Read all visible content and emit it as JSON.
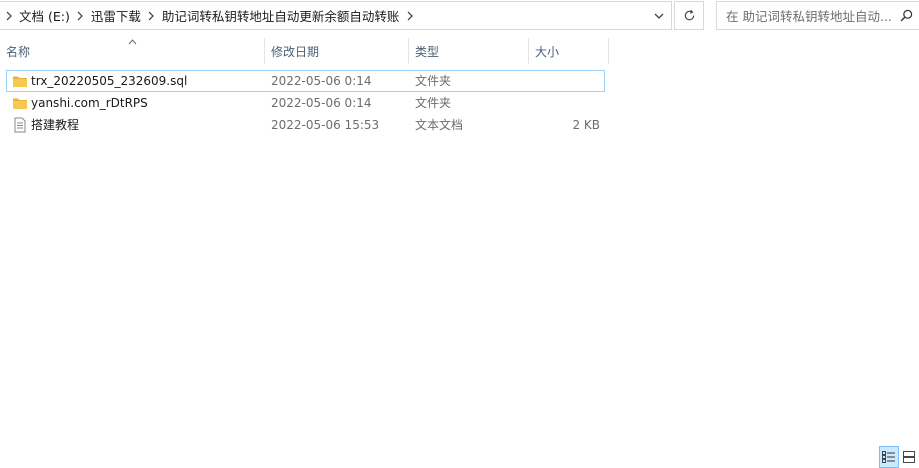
{
  "window": {
    "breadcrumbs": [
      "文档 (E:)",
      "迅雷下载",
      "助记词转私钥转地址自动更新余额自动转账"
    ]
  },
  "search": {
    "placeholder": "在 助记词转私钥转地址自动..."
  },
  "columns": {
    "name": "名称",
    "date": "修改日期",
    "type": "类型",
    "size": "大小"
  },
  "files": [
    {
      "name": "trx_20220505_232609.sql",
      "date": "2022-05-06 0:14",
      "type": "文件夹",
      "size": "",
      "icon": "folder-icon",
      "selected": true
    },
    {
      "name": "yanshi.com_rDtRPS",
      "date": "2022-05-06 0:14",
      "type": "文件夹",
      "size": "",
      "icon": "folder-icon",
      "selected": false
    },
    {
      "name": "搭建教程",
      "date": "2022-05-06 15:53",
      "type": "文本文档",
      "size": "2 KB",
      "icon": "text-document-icon",
      "selected": false
    }
  ],
  "colors": {
    "selection_border": "#99d1ff",
    "folder": "#f6c94e",
    "header_text": "#4c607a",
    "view_active": "#cce8ff"
  }
}
